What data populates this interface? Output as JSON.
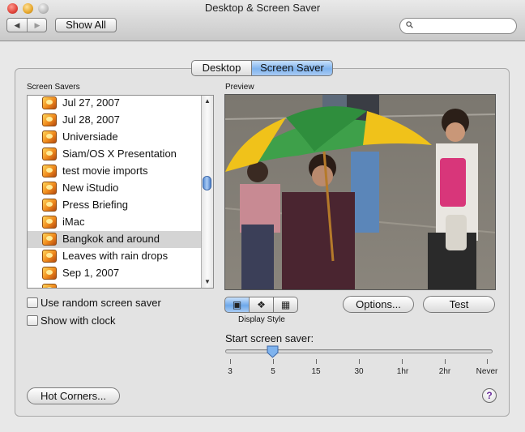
{
  "window": {
    "title": "Desktop & Screen Saver"
  },
  "toolbar": {
    "back_icon": "left-arrow-icon",
    "forward_icon": "right-arrow-icon",
    "show_all_label": "Show All",
    "search_value": ""
  },
  "tabs": [
    {
      "label": "Desktop",
      "selected": false
    },
    {
      "label": "Screen Saver",
      "selected": true
    }
  ],
  "screen_savers": {
    "heading": "Screen Savers",
    "items": [
      {
        "label": "Jul 27, 2007"
      },
      {
        "label": "Jul 28, 2007"
      },
      {
        "label": "Universiade"
      },
      {
        "label": "Siam/OS X Presentation"
      },
      {
        "label": "test movie imports"
      },
      {
        "label": "New iStudio"
      },
      {
        "label": "Press Briefing"
      },
      {
        "label": "iMac"
      },
      {
        "label": "Bangkok and around",
        "selected": true
      },
      {
        "label": "Leaves with rain drops"
      },
      {
        "label": "Sep 1, 2007"
      }
    ]
  },
  "options": {
    "random_label": "Use random screen saver",
    "random_checked": false,
    "clock_label": "Show with clock",
    "clock_checked": false
  },
  "preview": {
    "heading": "Preview"
  },
  "display_style": {
    "label": "Display Style",
    "selected": "slideshow"
  },
  "buttons": {
    "options_label": "Options...",
    "test_label": "Test",
    "hot_corners_label": "Hot Corners..."
  },
  "start_slider": {
    "label": "Start screen saver:",
    "ticks": [
      "3",
      "5",
      "15",
      "30",
      "1hr",
      "2hr",
      "Never"
    ],
    "selected": "5"
  },
  "help_label": "?"
}
